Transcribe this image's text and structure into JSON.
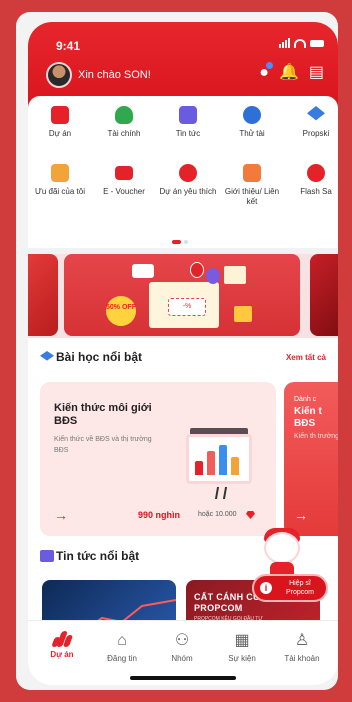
{
  "status_bar": {
    "time": "9:41"
  },
  "header": {
    "greeting": "Xin chào SON!"
  },
  "menu": {
    "row1": [
      {
        "label": "Dự án",
        "icon": "building-icon",
        "color": "#e5222a"
      },
      {
        "label": "Tài chính",
        "icon": "money-bag-icon",
        "color": "#2fa84f"
      },
      {
        "label": "Tin tức",
        "icon": "news-icon",
        "color": "#6a5be0"
      },
      {
        "label": "Thử tài",
        "icon": "trophy-icon",
        "color": "#2f6fd8"
      },
      {
        "label": "Propski",
        "icon": "graduation-cap-icon",
        "color": "#3a7be0"
      }
    ],
    "row2": [
      {
        "label": "Ưu đãi của tôi",
        "icon": "gift-icon",
        "color": "#f2a33a"
      },
      {
        "label": "E - Voucher",
        "icon": "voucher-icon",
        "color": "#e5222a"
      },
      {
        "label": "Dự án yêu thích",
        "icon": "heart-icon",
        "color": "#e5222a"
      },
      {
        "label": "Giới thiệu/ Liên kết",
        "icon": "referral-icon",
        "color": "#f27a3a"
      },
      {
        "label": "Flash Sa",
        "icon": "lightning-icon",
        "color": "#e5222a"
      }
    ]
  },
  "banner": {
    "sale": "50% OFF",
    "voucher_text": "-%"
  },
  "lessons": {
    "title": "Bài học nổi bật",
    "see_all": "Xem tất cả",
    "cards": [
      {
        "title": "Kiến thức môi giới BĐS",
        "desc": "Kiến thức về BĐS và thị trường BĐS",
        "price": "990 nghìn",
        "alt": "hoặc 10.000"
      },
      {
        "small": "Dành c",
        "title": "Kiến t BĐS",
        "desc": "Kiến th trường"
      }
    ]
  },
  "news": {
    "title": "Tin tức nổi bật",
    "card2_title": "CẤT CÁNH CÙNG PROPCOM",
    "card2_sub": "PROPCOM KÊU GỌI ĐẦU TƯ"
  },
  "helper": {
    "label": "Hiệp sĩ Propcom"
  },
  "tabs": [
    {
      "label": "Dự án",
      "icon": "propcom-logo-icon",
      "active": true
    },
    {
      "label": "Đăng tin",
      "icon": "post-icon",
      "active": false
    },
    {
      "label": "Nhóm",
      "icon": "group-icon",
      "active": false
    },
    {
      "label": "Sự kiện",
      "icon": "calendar-icon",
      "active": false
    },
    {
      "label": "Tài khoản",
      "icon": "user-icon",
      "active": false
    }
  ],
  "colors": {
    "brand": "#e5222a",
    "background": "#d03b3b"
  }
}
